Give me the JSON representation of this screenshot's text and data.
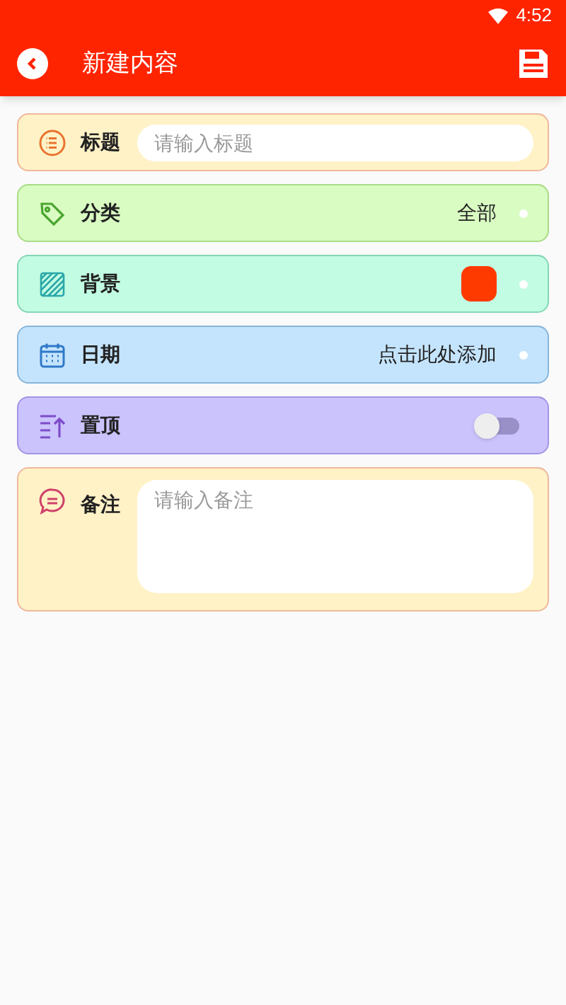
{
  "status_bar": {
    "time": "4:52"
  },
  "app_bar": {
    "title": "新建内容"
  },
  "rows": [
    {
      "kind": "input",
      "label": "标题",
      "placeholder": "请输入标题"
    },
    {
      "kind": "value",
      "label": "分类",
      "value": "全部"
    },
    {
      "kind": "swatch",
      "label": "背景",
      "color": "#ff3a00"
    },
    {
      "kind": "value",
      "label": "日期",
      "value": "点击此处添加"
    },
    {
      "kind": "toggle",
      "label": "置顶",
      "on": false
    },
    {
      "kind": "textarea",
      "label": "备注",
      "placeholder": "请输入备注"
    }
  ]
}
